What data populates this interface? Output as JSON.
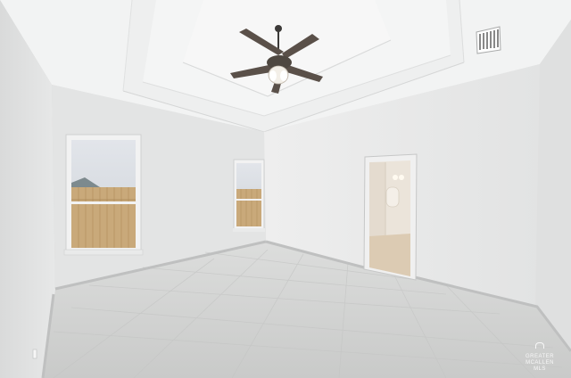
{
  "scene": {
    "description_free": true,
    "colors": {
      "wall_left": "#e4e5e5",
      "wall_back": "#e6e7e7",
      "wall_right": "#e9eaea",
      "ceiling": "#f1f2f2",
      "floor": "#d3d4d3",
      "fence": "#c9a97a",
      "sky": "#d9dde2",
      "fan_blade": "#5a5049",
      "baseboard": "#c8c9c9"
    },
    "icons": [
      "ceiling-fan-icon",
      "air-vent-icon",
      "light-switch-icon"
    ]
  },
  "watermark": {
    "line1": "GREATER MCALLEN",
    "line2": "MLS"
  }
}
